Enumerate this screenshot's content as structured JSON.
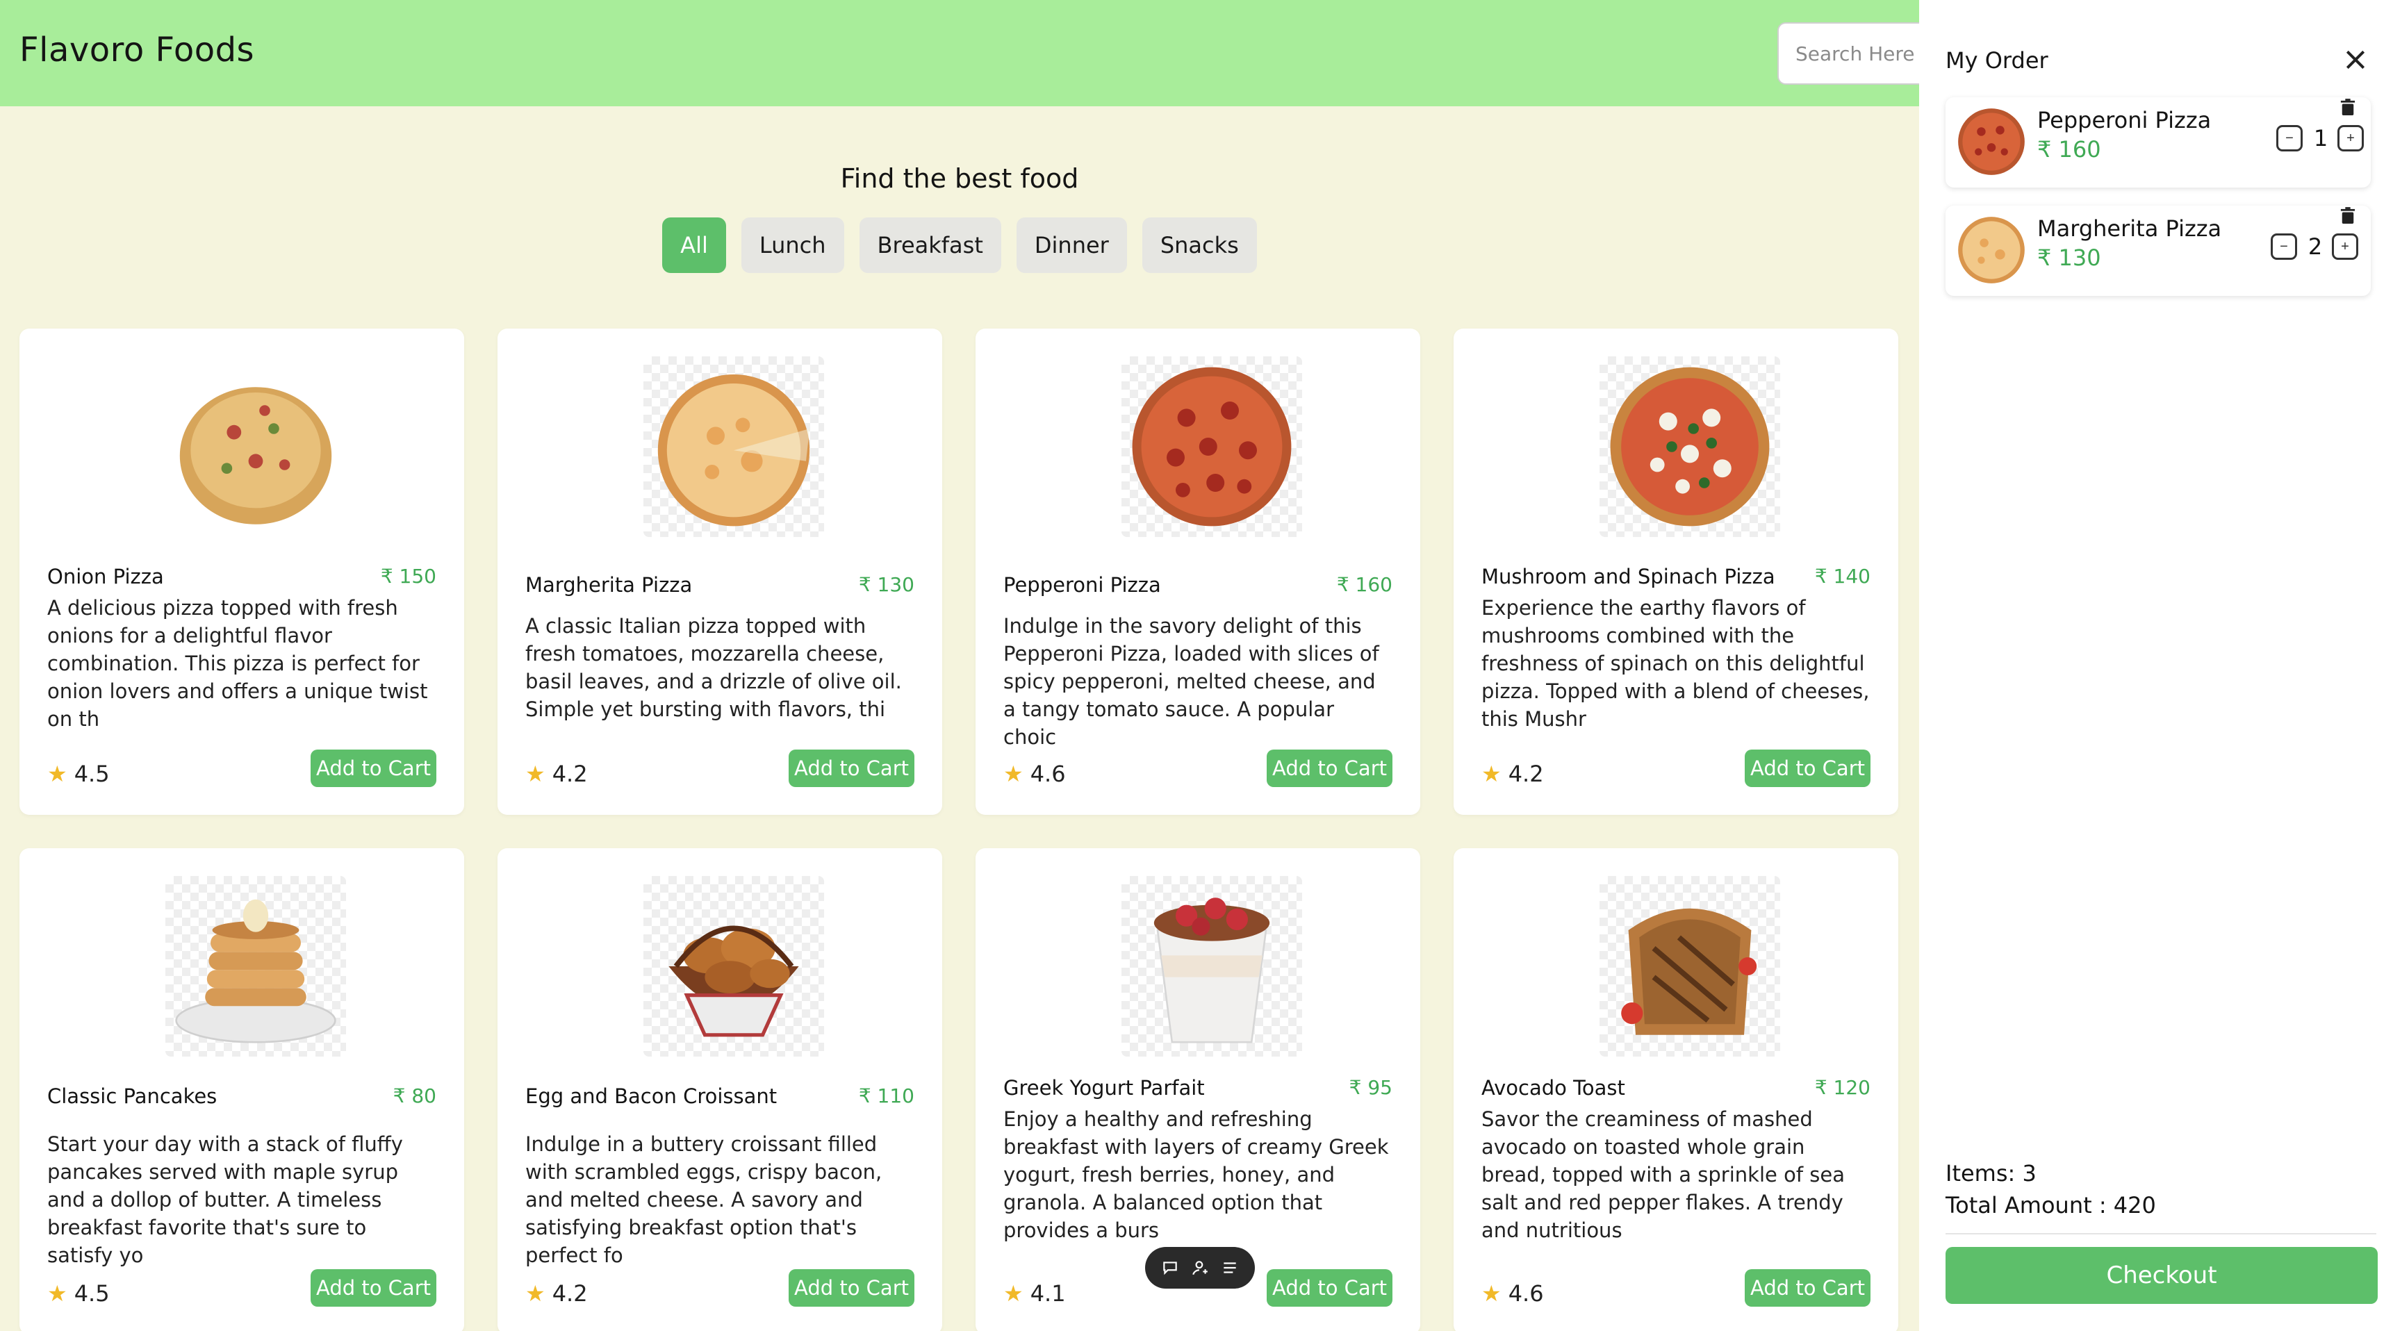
{
  "header": {
    "brand": "Flavoro Foods",
    "search_placeholder": "Search Here"
  },
  "main": {
    "heading": "Find the best food",
    "filters": [
      "All",
      "Lunch",
      "Breakfast",
      "Dinner",
      "Snacks"
    ],
    "active_filter": "All",
    "add_to_cart_label": "Add to Cart",
    "cards": [
      {
        "name": "Onion Pizza",
        "price": "₹ 150",
        "rating": "4.5",
        "description": "A delicious pizza topped with fresh onions for a delightful flavor combination. This pizza is perfect for onion lovers and offers a unique twist on th",
        "image": "onion-pizza"
      },
      {
        "name": "Margherita Pizza",
        "price": "₹ 130",
        "rating": "4.2",
        "description": "A classic Italian pizza topped with fresh tomatoes, mozzarella cheese, basil leaves, and a drizzle of olive oil. Simple yet bursting with flavors, thi",
        "image": "margherita-pizza"
      },
      {
        "name": "Pepperoni Pizza",
        "price": "₹ 160",
        "rating": "4.6",
        "description": "Indulge in the savory delight of this Pepperoni Pizza, loaded with slices of spicy pepperoni, melted cheese, and a tangy tomato sauce. A popular choic",
        "image": "pepperoni-pizza"
      },
      {
        "name": "Mushroom and Spinach Pizza",
        "price": "₹ 140",
        "rating": "4.2",
        "description": "Experience the earthy flavors of mushrooms combined with the freshness of spinach on this delightful pizza. Topped with a blend of cheeses, this Mushr",
        "image": "mushroom-spinach-pizza"
      },
      {
        "name": "Classic Pancakes",
        "price": "₹ 80",
        "rating": "4.5",
        "description": "Start your day with a stack of fluffy pancakes served with maple syrup and a dollop of butter. A timeless breakfast favorite that's sure to satisfy yo",
        "image": "pancakes"
      },
      {
        "name": "Egg and Bacon Croissant",
        "price": "₹ 110",
        "rating": "4.2",
        "description": "Indulge in a buttery croissant filled with scrambled eggs, crispy bacon, and melted cheese. A savory and satisfying breakfast option that's perfect fo",
        "image": "croissant-basket"
      },
      {
        "name": "Greek Yogurt Parfait",
        "price": "₹ 95",
        "rating": "4.1",
        "description": "Enjoy a healthy and refreshing breakfast with layers of creamy Greek yogurt, fresh berries, honey, and granola. A balanced option that provides a burs",
        "image": "yogurt-parfait"
      },
      {
        "name": "Avocado Toast",
        "price": "₹ 120",
        "rating": "4.6",
        "description": "Savor the creaminess of mashed avocado on toasted whole grain bread, topped with a sprinkle of sea salt and red pepper flakes. A trendy and nutritious",
        "image": "toast"
      }
    ]
  },
  "sidebar": {
    "title": "My Order",
    "items": [
      {
        "name": "Pepperoni Pizza",
        "price": "₹ 160",
        "qty": "1",
        "image": "pepperoni-pizza"
      },
      {
        "name": "Margherita Pizza",
        "price": "₹ 130",
        "qty": "2",
        "image": "margherita-pizza"
      }
    ],
    "items_count": "Items: 3",
    "total": "Total Amount : 420",
    "checkout_label": "Checkout"
  },
  "icons": {
    "close": "close-icon",
    "trash": "trash-icon",
    "minus": "minus-icon",
    "plus": "plus-icon",
    "star": "star-icon",
    "chat": "chat-icon",
    "user": "user-icon",
    "menu": "menu-icon"
  },
  "colors": {
    "header_bg": "#a8ed9a",
    "page_bg": "#f5f4dd",
    "accent": "#5dbf6a",
    "price_green": "#3fa954",
    "star": "#f1b928"
  }
}
